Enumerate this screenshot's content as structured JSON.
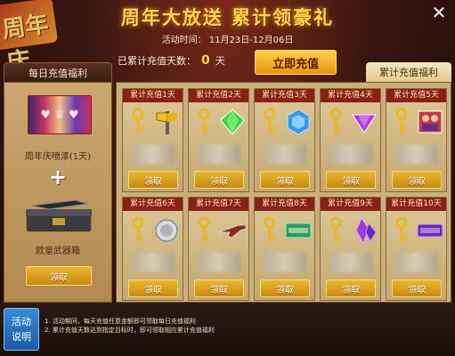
{
  "header": {
    "title": "周年大放送  累计领豪礼",
    "time_label": "活动时间：",
    "time_range": "11月23日-12月06日",
    "decor_text": "周年庆"
  },
  "summary": {
    "label": "已累计充值天数：",
    "days": "0",
    "unit": "天",
    "recharge_button": "立即充值"
  },
  "tabs": {
    "daily": "每日充值福利",
    "accumulated": "累计充值福利"
  },
  "daily": {
    "item1_label": "周年庆喷漆(1天)",
    "plus": "+",
    "item2_label": "欧皇武器箱",
    "claim": "领取"
  },
  "accumulated": {
    "cards": [
      {
        "head": "累计充值1天",
        "prize": "axe-icon",
        "claim": "领取"
      },
      {
        "head": "累计充值2天",
        "prize": "green-gem-icon",
        "claim": "领取"
      },
      {
        "head": "累计充值3天",
        "prize": "blue-gem-icon",
        "claim": "领取"
      },
      {
        "head": "累计充值4天",
        "prize": "purple-gem-icon",
        "claim": "领取"
      },
      {
        "head": "累计充值5天",
        "prize": "character-icon",
        "claim": "领取"
      },
      {
        "head": "累计充值6天",
        "prize": "silver-coin-icon",
        "claim": "领取"
      },
      {
        "head": "累计充值7天",
        "prize": "rifle-icon",
        "claim": "领取"
      },
      {
        "head": "累计充值8天",
        "prize": "card-icon",
        "claim": "领取"
      },
      {
        "head": "累计充值9天",
        "prize": "purple-crystal-icon",
        "claim": "领取"
      },
      {
        "head": "累计充值10天",
        "prize": "ticket-icon",
        "claim": "领取"
      }
    ]
  },
  "footer": {
    "explain_line1": "活动",
    "explain_line2": "说明",
    "note1": "1. 活动期间，每天充值任意金额即可领取每日充值福利",
    "note2": "2. 累计充值天数达到指定目标时，即可领取相应累计充值福利"
  },
  "colors": {
    "title": "#ffd84a",
    "card_head": "#8a2014",
    "claim_button": "#e8b830"
  }
}
